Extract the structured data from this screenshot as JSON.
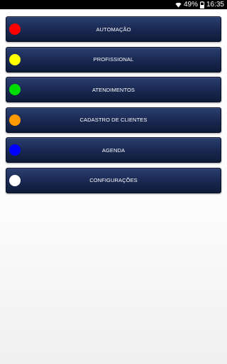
{
  "status_bar": {
    "battery_percent": "49%",
    "time": "16:35",
    "icons": [
      "wifi-icon",
      "battery-icon"
    ]
  },
  "menu": {
    "items": [
      {
        "label": "AUTOMAÇÃO",
        "dot_color": "#ff0000"
      },
      {
        "label": "PROFISSIONAL",
        "dot_color": "#ffff00"
      },
      {
        "label": "ATENDIMENTOS",
        "dot_color": "#00dd00"
      },
      {
        "label": "CADASTRO DE CLIENTES",
        "dot_color": "#ff9900"
      },
      {
        "label": "AGENDA",
        "dot_color": "#0000ff"
      },
      {
        "label": "CONFIGURAÇÕES",
        "dot_color": "#ffffff"
      }
    ]
  }
}
